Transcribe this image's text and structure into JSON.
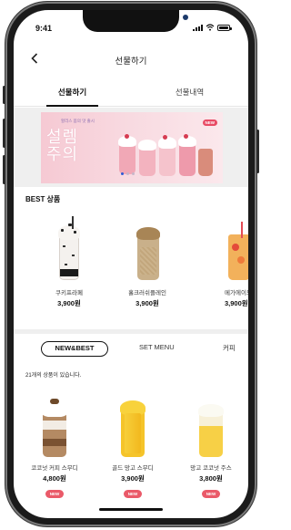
{
  "status_bar": {
    "time": "9:41"
  },
  "header": {
    "title": "선물하기"
  },
  "top_tabs": [
    {
      "label": "선물하기",
      "active": true
    },
    {
      "label": "선물내역",
      "active": false
    }
  ],
  "banner": {
    "small_text": "할리스 봄의 맛 출시",
    "headline_1": "설렘",
    "headline_2": "주의",
    "badge": "NEW",
    "dots": [
      true,
      false,
      false
    ]
  },
  "best": {
    "title": "BEST 상품",
    "items": [
      {
        "name": "쿠키프라페",
        "price": "3,900원"
      },
      {
        "name": "홀크러쉬플레인",
        "price": "3,900원"
      },
      {
        "name": "메가에이드",
        "price": "3,900원"
      }
    ]
  },
  "category_tabs": [
    {
      "label": "NEW&BEST",
      "active": true
    },
    {
      "label": "SET MENU",
      "active": false
    },
    {
      "label": "커피",
      "active": false
    }
  ],
  "count_text": "21개의 상품이 있습니다.",
  "new_items": [
    {
      "name": "코코넛 커피 스무디",
      "price": "4,800원",
      "badge": "NEW"
    },
    {
      "name": "골드 망고 스무디",
      "price": "3,900원",
      "badge": "NEW"
    },
    {
      "name": "망고 코코넛 주스",
      "price": "3,800원",
      "badge": "NEW"
    }
  ],
  "colors": {
    "badge": "#ea5a69",
    "banner_bg": "#f6c9d3",
    "dot_active": "#2d5bd6"
  }
}
